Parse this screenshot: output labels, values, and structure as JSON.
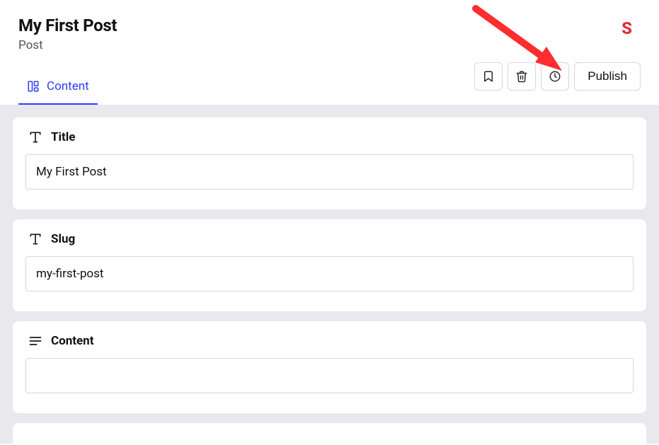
{
  "header": {
    "title": "My First Post",
    "subtitle": "Post",
    "brand": "S"
  },
  "tabs": {
    "content": "Content"
  },
  "actions": {
    "publish": "Publish"
  },
  "fields": {
    "title": {
      "label": "Title",
      "value": "My First Post"
    },
    "slug": {
      "label": "Slug",
      "value": "my-first-post"
    },
    "content": {
      "label": "Content",
      "value": ""
    }
  }
}
